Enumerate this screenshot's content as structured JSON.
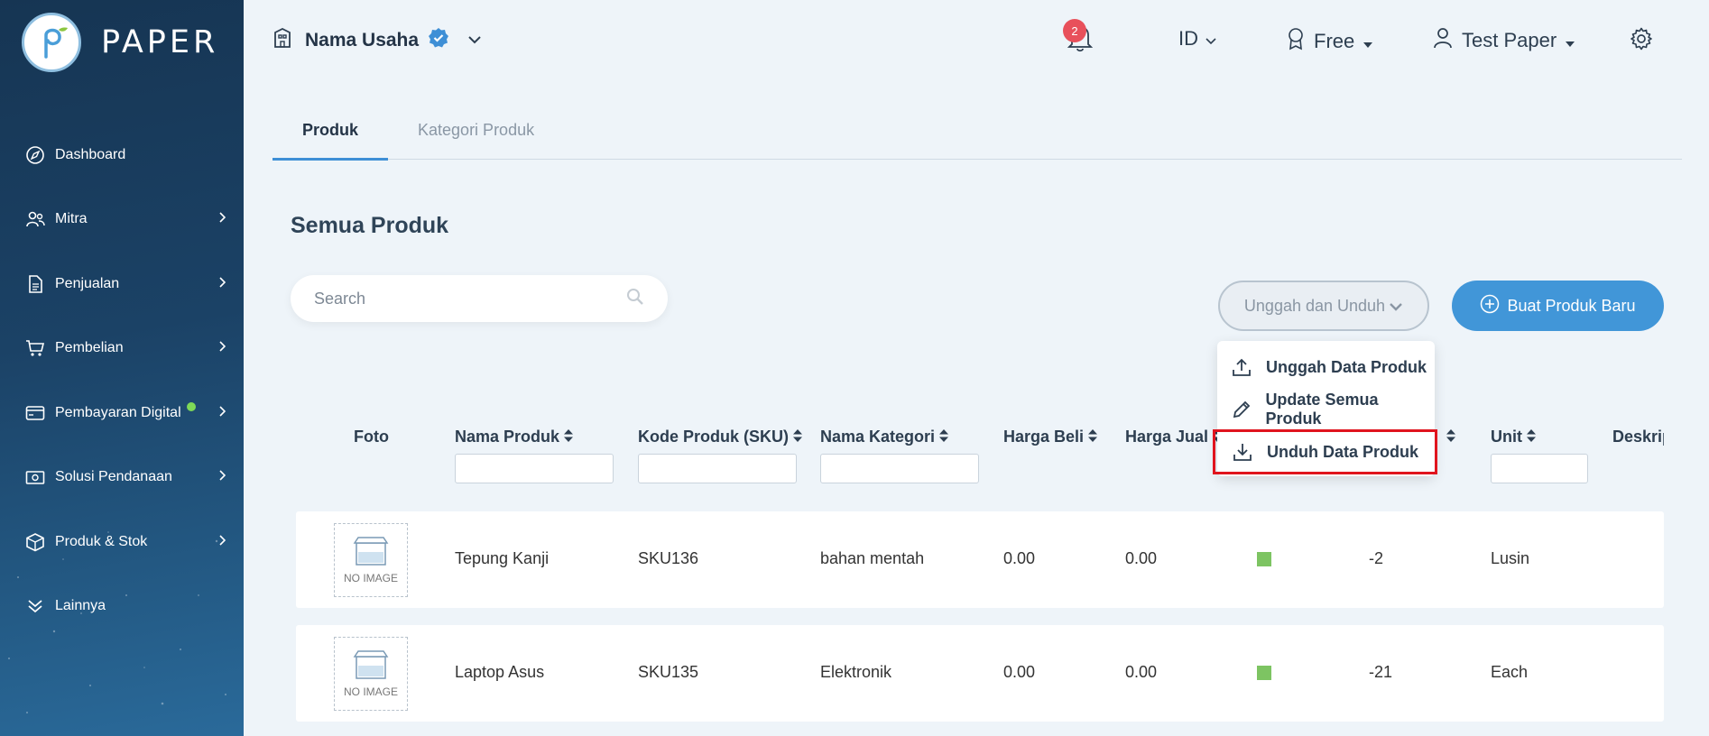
{
  "brand": {
    "name": "PAPER"
  },
  "sidebar": {
    "items": [
      {
        "label": "Dashboard",
        "icon": "compass-icon",
        "has_arrow": false
      },
      {
        "label": "Mitra",
        "icon": "users-icon",
        "has_arrow": true
      },
      {
        "label": "Penjualan",
        "icon": "document-icon",
        "has_arrow": true
      },
      {
        "label": "Pembelian",
        "icon": "cart-icon",
        "has_arrow": true
      },
      {
        "label": "Pembayaran Digital",
        "icon": "card-icon",
        "has_arrow": true,
        "indicator": "green-dot"
      },
      {
        "label": "Solusi Pendanaan",
        "icon": "money-icon",
        "has_arrow": true
      },
      {
        "label": "Produk & Stok",
        "icon": "box-icon",
        "has_arrow": true
      },
      {
        "label": "Lainnya",
        "icon": "chevrons-down-icon",
        "has_arrow": false
      }
    ]
  },
  "header": {
    "business_name": "Nama Usaha",
    "notification_count": "2",
    "language": "ID",
    "plan": "Free",
    "user": "Test Paper"
  },
  "tabs": [
    {
      "label": "Produk",
      "active": true
    },
    {
      "label": "Kategori Produk",
      "active": false
    }
  ],
  "page": {
    "title": "Semua Produk",
    "search_placeholder": "Search",
    "upload_download_label": "Unggah dan Unduh",
    "new_product_label": "Buat Produk Baru"
  },
  "dropdown": {
    "items": [
      {
        "label": "Unggah Data Produk",
        "icon": "upload-icon"
      },
      {
        "label": "Update Semua Produk",
        "icon": "pencil-icon"
      },
      {
        "label": "Unduh Data Produk",
        "icon": "download-icon",
        "highlighted": true
      }
    ]
  },
  "table": {
    "columns": {
      "foto": "Foto",
      "nama": "Nama Produk",
      "kode": "Kode Produk (SKU)",
      "kategori": "Nama Kategori",
      "harga_beli": "Harga Beli",
      "harga_jual": "Harga Jual",
      "unit": "Unit",
      "deskripsi": "Deskrip"
    },
    "no_image_label": "NO IMAGE",
    "rows": [
      {
        "nama": "Tepung Kanji",
        "kode": "SKU136",
        "kategori": "bahan mentah",
        "harga_beli": "0.00",
        "harga_jual": "0.00",
        "stok": "-2",
        "unit": "Lusin"
      },
      {
        "nama": "Laptop Asus",
        "kode": "SKU135",
        "kategori": "Elektronik",
        "harga_beli": "0.00",
        "harga_jual": "0.00",
        "stok": "-21",
        "unit": "Each"
      }
    ]
  },
  "colors": {
    "primary": "#4196d8",
    "sidebar": "#1b4266",
    "badge": "#e8505b",
    "highlight": "#e0141e",
    "status_green": "#7dc462"
  }
}
